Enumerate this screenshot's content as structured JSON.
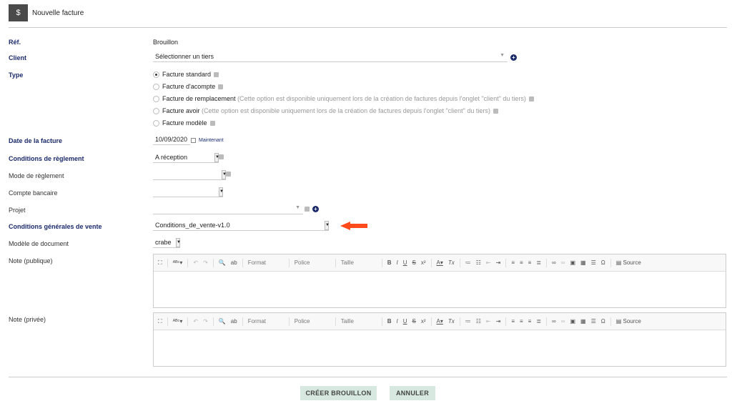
{
  "header": {
    "title": "Nouvelle facture",
    "icon": "invoice-dollar-icon"
  },
  "fields": {
    "ref": {
      "label": "Réf.",
      "value": "Brouillon"
    },
    "client": {
      "label": "Client",
      "value": "Sélectionner un tiers"
    },
    "type": {
      "label": "Type",
      "options": [
        {
          "label": "Facture standard",
          "note": "",
          "selected": true
        },
        {
          "label": "Facture d'acompte",
          "note": "",
          "selected": false
        },
        {
          "label": "Facture de remplacement",
          "note": "(Cette option est disponible uniquement lors de la création de factures depuis l'onglet \"client\" du tiers)",
          "selected": false
        },
        {
          "label": "Facture avoir",
          "note": "(Cette option est disponible uniquement lors de la création de factures depuis l'onglet \"client\" du tiers)",
          "selected": false
        },
        {
          "label": "Facture modèle",
          "note": "",
          "selected": false
        }
      ]
    },
    "date": {
      "label": "Date de la facture",
      "value": "10/09/2020",
      "now_link": "Maintenant"
    },
    "payment_terms": {
      "label": "Conditions de règlement",
      "value": "A réception"
    },
    "payment_mode": {
      "label": "Mode de règlement",
      "value": ""
    },
    "bank_account": {
      "label": "Compte bancaire",
      "value": ""
    },
    "project": {
      "label": "Projet",
      "value": ""
    },
    "cgv": {
      "label": "Conditions générales de vente",
      "value": "Conditions_de_vente-v1.0"
    },
    "doc_model": {
      "label": "Modèle de document",
      "value": "crabe"
    },
    "note_public": {
      "label": "Note (publique)"
    },
    "note_private": {
      "label": "Note (privée)"
    }
  },
  "toolbar": {
    "format": "Format",
    "font": "Police",
    "size": "Taille",
    "source": "Source"
  },
  "buttons": {
    "create": "CRÉER BROUILLON",
    "cancel": "ANNULER"
  },
  "colors": {
    "accent": "#1b2a6b",
    "button_bg": "#d6e8df",
    "arrow": "#ff4a1c"
  }
}
